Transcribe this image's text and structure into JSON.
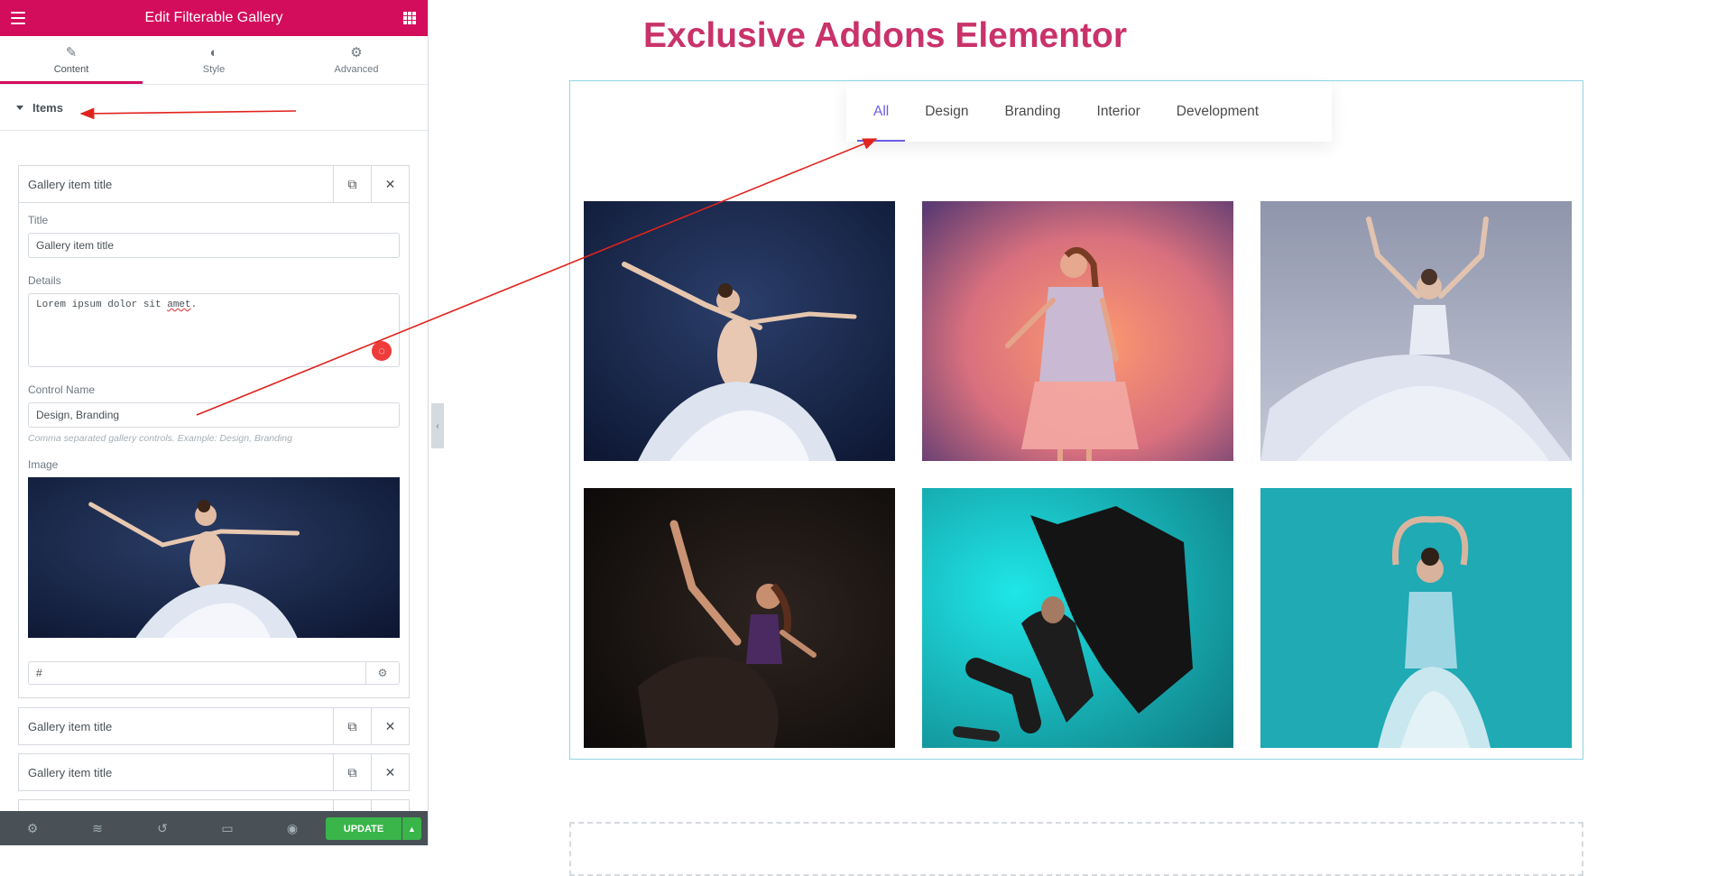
{
  "panel": {
    "title": "Edit Filterable Gallery",
    "tabs": [
      {
        "label": "Content",
        "icon": "pencil-icon"
      },
      {
        "label": "Style",
        "icon": "half-circle-icon"
      },
      {
        "label": "Advanced",
        "icon": "gear-icon"
      }
    ],
    "section_label": "Items",
    "items": [
      {
        "title": "Gallery item title",
        "expanded": true,
        "fields": {
          "title_label": "Title",
          "title_value": "Gallery item title",
          "details_label": "Details",
          "details_value_start": "Lorem ipsum dolor sit ",
          "details_value_misspelled": "amet",
          "details_value_end": ".",
          "control_label": "Control Name",
          "control_value": "Design, Branding",
          "control_hint": "Comma separated gallery controls. Example: Design, Branding",
          "image_label": "Image",
          "link_value": "#"
        }
      },
      {
        "title": "Gallery item title",
        "expanded": false
      },
      {
        "title": "Gallery item title",
        "expanded": false
      }
    ],
    "footer": {
      "icons": [
        "gear-icon",
        "layers-icon",
        "history-icon",
        "responsive-icon",
        "eye-icon"
      ],
      "update_label": "UPDATE"
    }
  },
  "preview": {
    "heading": "Exclusive Addons Elementor",
    "filters": [
      "All",
      "Design",
      "Branding",
      "Interior",
      "Development"
    ],
    "active_filter": "All",
    "accent_color": "#6b5ce7",
    "heading_color": "#c9326a",
    "photos": [
      {
        "alt": "ballerina leaping on dark blue background"
      },
      {
        "alt": "girl in pink dress with orange glow"
      },
      {
        "alt": "dancer in flowing white dress with arms raised"
      },
      {
        "alt": "dancer high kick in low light"
      },
      {
        "alt": "hip hop dancer in black on cyan background"
      },
      {
        "alt": "ballerina in light blue on teal background"
      }
    ]
  },
  "colors": {
    "brand": "#d30c5c",
    "update": "#39b54a",
    "footer": "#495157"
  }
}
